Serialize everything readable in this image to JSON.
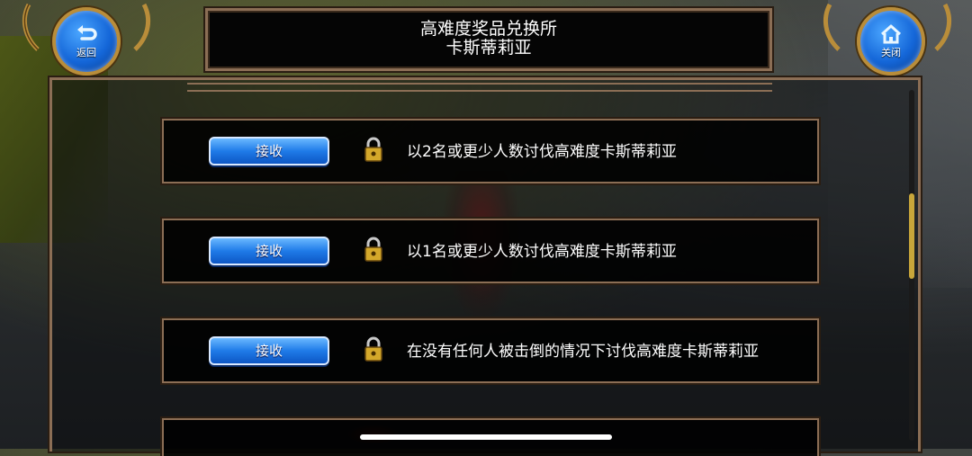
{
  "header": {
    "back_label": "返回",
    "close_label": "关闭",
    "title_line1": "高难度奖品兑换所",
    "title_line2": "卡斯蒂莉亚"
  },
  "rewards": [
    {
      "button_label": "接收",
      "locked": true,
      "description": "以2名或更少人数讨伐高难度卡斯蒂莉亚"
    },
    {
      "button_label": "接收",
      "locked": true,
      "description": "以1名或更少人数讨伐高难度卡斯蒂莉亚"
    },
    {
      "button_label": "接收",
      "locked": true,
      "description": "在没有任何人被击倒的情况下讨伐高难度卡斯蒂莉亚"
    }
  ],
  "colors": {
    "frame_bronze": "#8b6e55",
    "button_blue": "#1f7be8",
    "lock_gold": "#d4a82a"
  },
  "icons": [
    "back-arrow-icon",
    "home-icon",
    "lock-icon"
  ]
}
